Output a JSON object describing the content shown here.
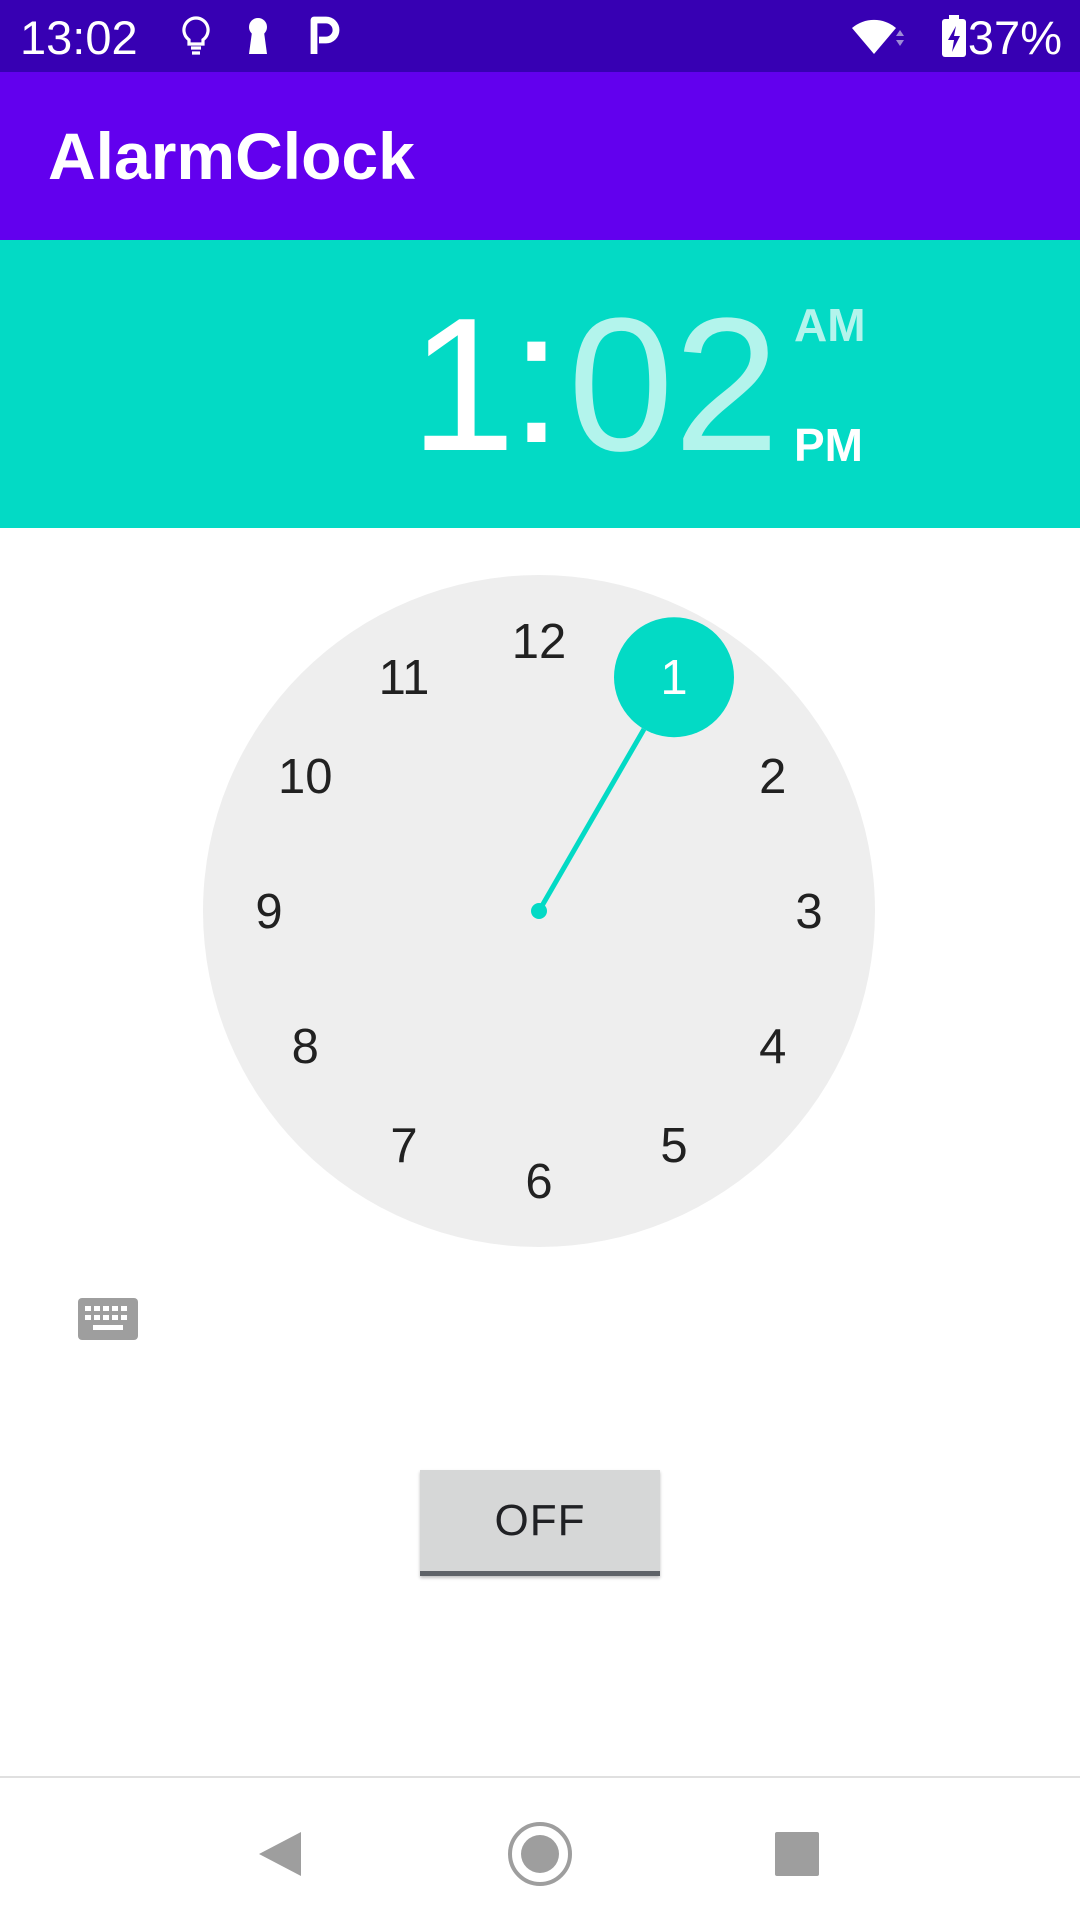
{
  "status_bar": {
    "time": "13:02",
    "battery": "37%",
    "icons": [
      "lightbulb-icon",
      "keyhole-icon",
      "parking-icon",
      "wifi-icon",
      "battery-charging-icon"
    ]
  },
  "app_bar": {
    "title": "AlarmClock"
  },
  "time_header": {
    "hour": "1",
    "separator": ":",
    "minute": "02",
    "am_label": "AM",
    "pm_label": "PM",
    "selected_period": "PM",
    "accent_color": "#03dac5"
  },
  "clock_dial": {
    "numbers": [
      "12",
      "1",
      "2",
      "3",
      "4",
      "5",
      "6",
      "7",
      "8",
      "9",
      "10",
      "11"
    ],
    "selected_hour": "1"
  },
  "keyboard_toggle": {
    "icon": "keyboard-icon"
  },
  "toggle_button": {
    "label": "OFF"
  },
  "nav_bar": {
    "icons": [
      "back-icon",
      "home-icon",
      "recents-icon"
    ]
  }
}
